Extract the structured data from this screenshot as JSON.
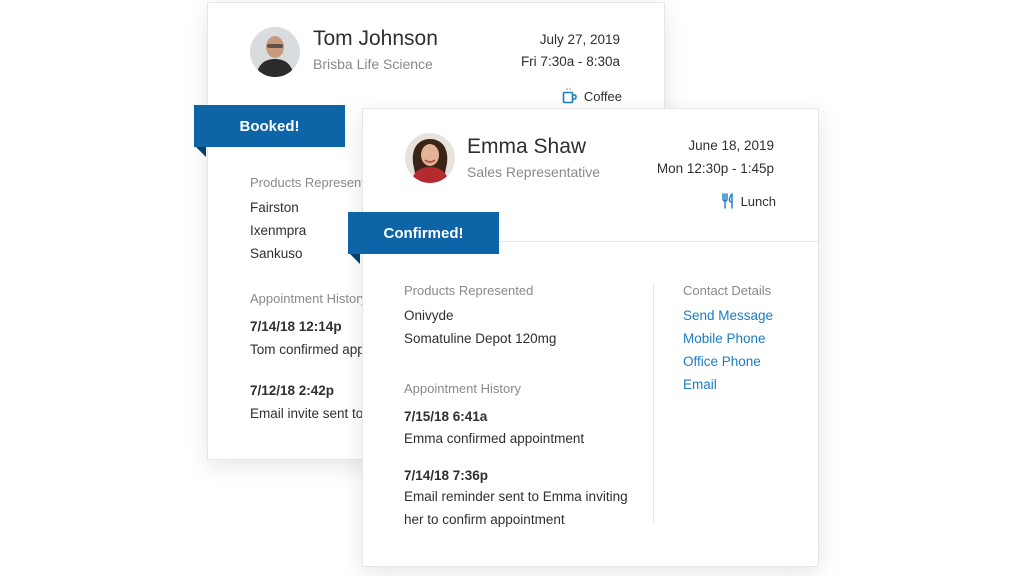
{
  "back_card": {
    "name": "Tom Johnson",
    "company": "Brisba Life Science",
    "date": "July 27, 2019",
    "time": "Fri 7:30a - 8:30a",
    "meal": "Coffee",
    "meal_icon": "coffee-cup-icon",
    "status": "Booked!",
    "products_label": "Products Represented",
    "products": [
      "Fairston",
      "Ixenmpra",
      "Sankuso"
    ],
    "history_label": "Appointment History",
    "history": [
      {
        "timestamp": "7/14/18 12:14p",
        "text": "Tom confirmed appointment"
      },
      {
        "timestamp": "7/12/18 2:42p",
        "text": "Email invite sent to Tom"
      }
    ]
  },
  "front_card": {
    "name": "Emma Shaw",
    "title": "Sales Representative",
    "date": "June 18, 2019",
    "time": "Mon 12:30p - 1:45p",
    "meal": "Lunch",
    "meal_icon": "fork-knife-icon",
    "status": "Confirmed!",
    "products_label": "Products Represented",
    "products": [
      "Onivyde",
      "Somatuline Depot 120mg"
    ],
    "history_label": "Appointment History",
    "history": [
      {
        "timestamp": "7/15/18 6:41a",
        "text": "Emma confirmed appointment"
      },
      {
        "timestamp": "7/14/18 7:36p",
        "text_line1": "Email reminder sent to Emma inviting",
        "text_line2": "her to confirm appointment"
      }
    ],
    "contact_label": "Contact Details",
    "contact_links": [
      "Send Message",
      "Mobile Phone",
      "Office Phone",
      "Email"
    ]
  },
  "colors": {
    "ribbon": "#0d65a8",
    "ribbon_fold": "#083f6a",
    "link": "#1b7cc4"
  }
}
